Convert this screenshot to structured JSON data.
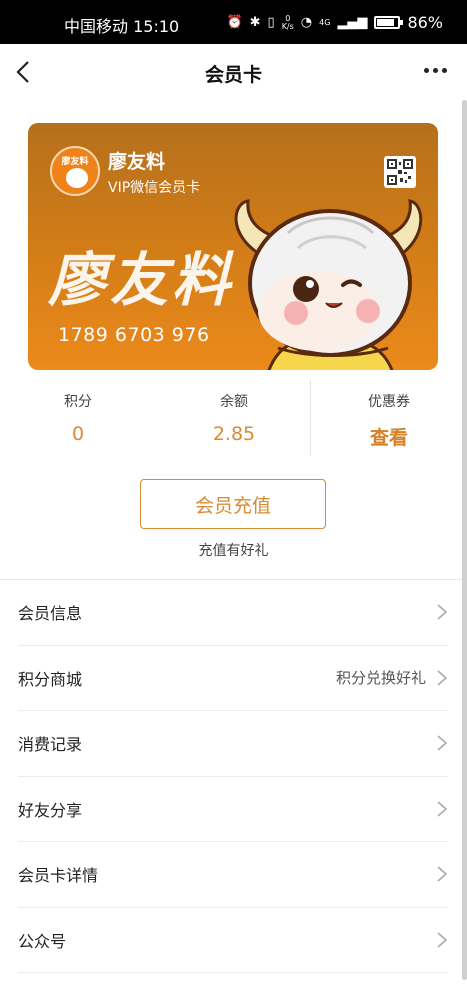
{
  "status_bar": {
    "carrier_time": "中国移动 15:10",
    "speed_value": "0",
    "speed_unit": "K/s",
    "network": "4G",
    "battery_text": "86%",
    "battery_level": 0.86
  },
  "nav": {
    "title": "会员卡"
  },
  "card": {
    "brand": "廖友料",
    "subtitle": "VIP微信会员卡",
    "logo_text": "廖友料",
    "big_text": "廖友料",
    "number": "1789 6703 976",
    "colors": {
      "top": "#b5701c",
      "bottom": "#ec8a1b"
    }
  },
  "stats": [
    {
      "label": "积分",
      "value": "0"
    },
    {
      "label": "余额",
      "value": "2.85"
    },
    {
      "label": "优惠券",
      "value": "查看"
    }
  ],
  "recharge": {
    "button_label": "会员充值",
    "tip": "充值有好礼",
    "accent": "#d88b33"
  },
  "menu": [
    {
      "label": "会员信息",
      "hint": ""
    },
    {
      "label": "积分商城",
      "hint": "积分兑换好礼"
    },
    {
      "label": "消费记录",
      "hint": ""
    },
    {
      "label": "好友分享",
      "hint": ""
    },
    {
      "label": "会员卡详情",
      "hint": ""
    },
    {
      "label": "公众号",
      "hint": ""
    }
  ]
}
